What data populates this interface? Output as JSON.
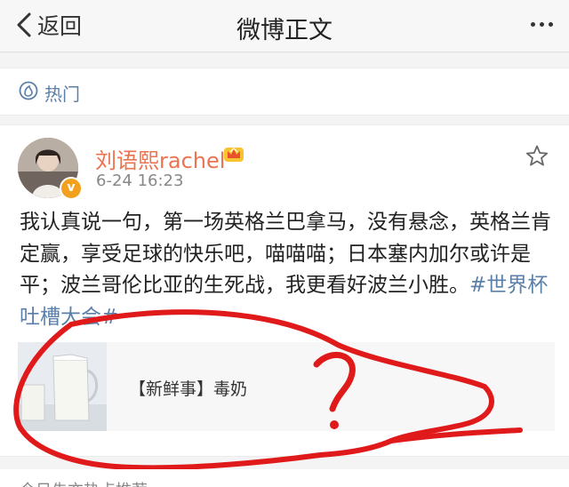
{
  "navbar": {
    "back_label": "返回",
    "title": "微博正文"
  },
  "hot_bar": {
    "label": "热门"
  },
  "post": {
    "user_name": "刘语熙rachel",
    "time": "6-24 16:23",
    "badge_letter": "v",
    "text": "我认真说一句，第一场英格兰巴拿马，没有悬念，英格兰肯定赢，享受足球的快乐吧，喵喵喵；日本塞内加尔或许是平；波兰哥伦比亚的生死战，我更看好波兰小胜。",
    "hashtag": "#世界杯吐槽大会#",
    "card": {
      "text": "【新鲜事】毒奶"
    }
  },
  "annotation": {
    "color": "#e01a1a",
    "mark": "?"
  },
  "next_item": {
    "text": "今日先亦热点推荐"
  },
  "colors": {
    "link": "#5a7fa8",
    "username": "#eb7350",
    "badge": "#f2a01e"
  }
}
